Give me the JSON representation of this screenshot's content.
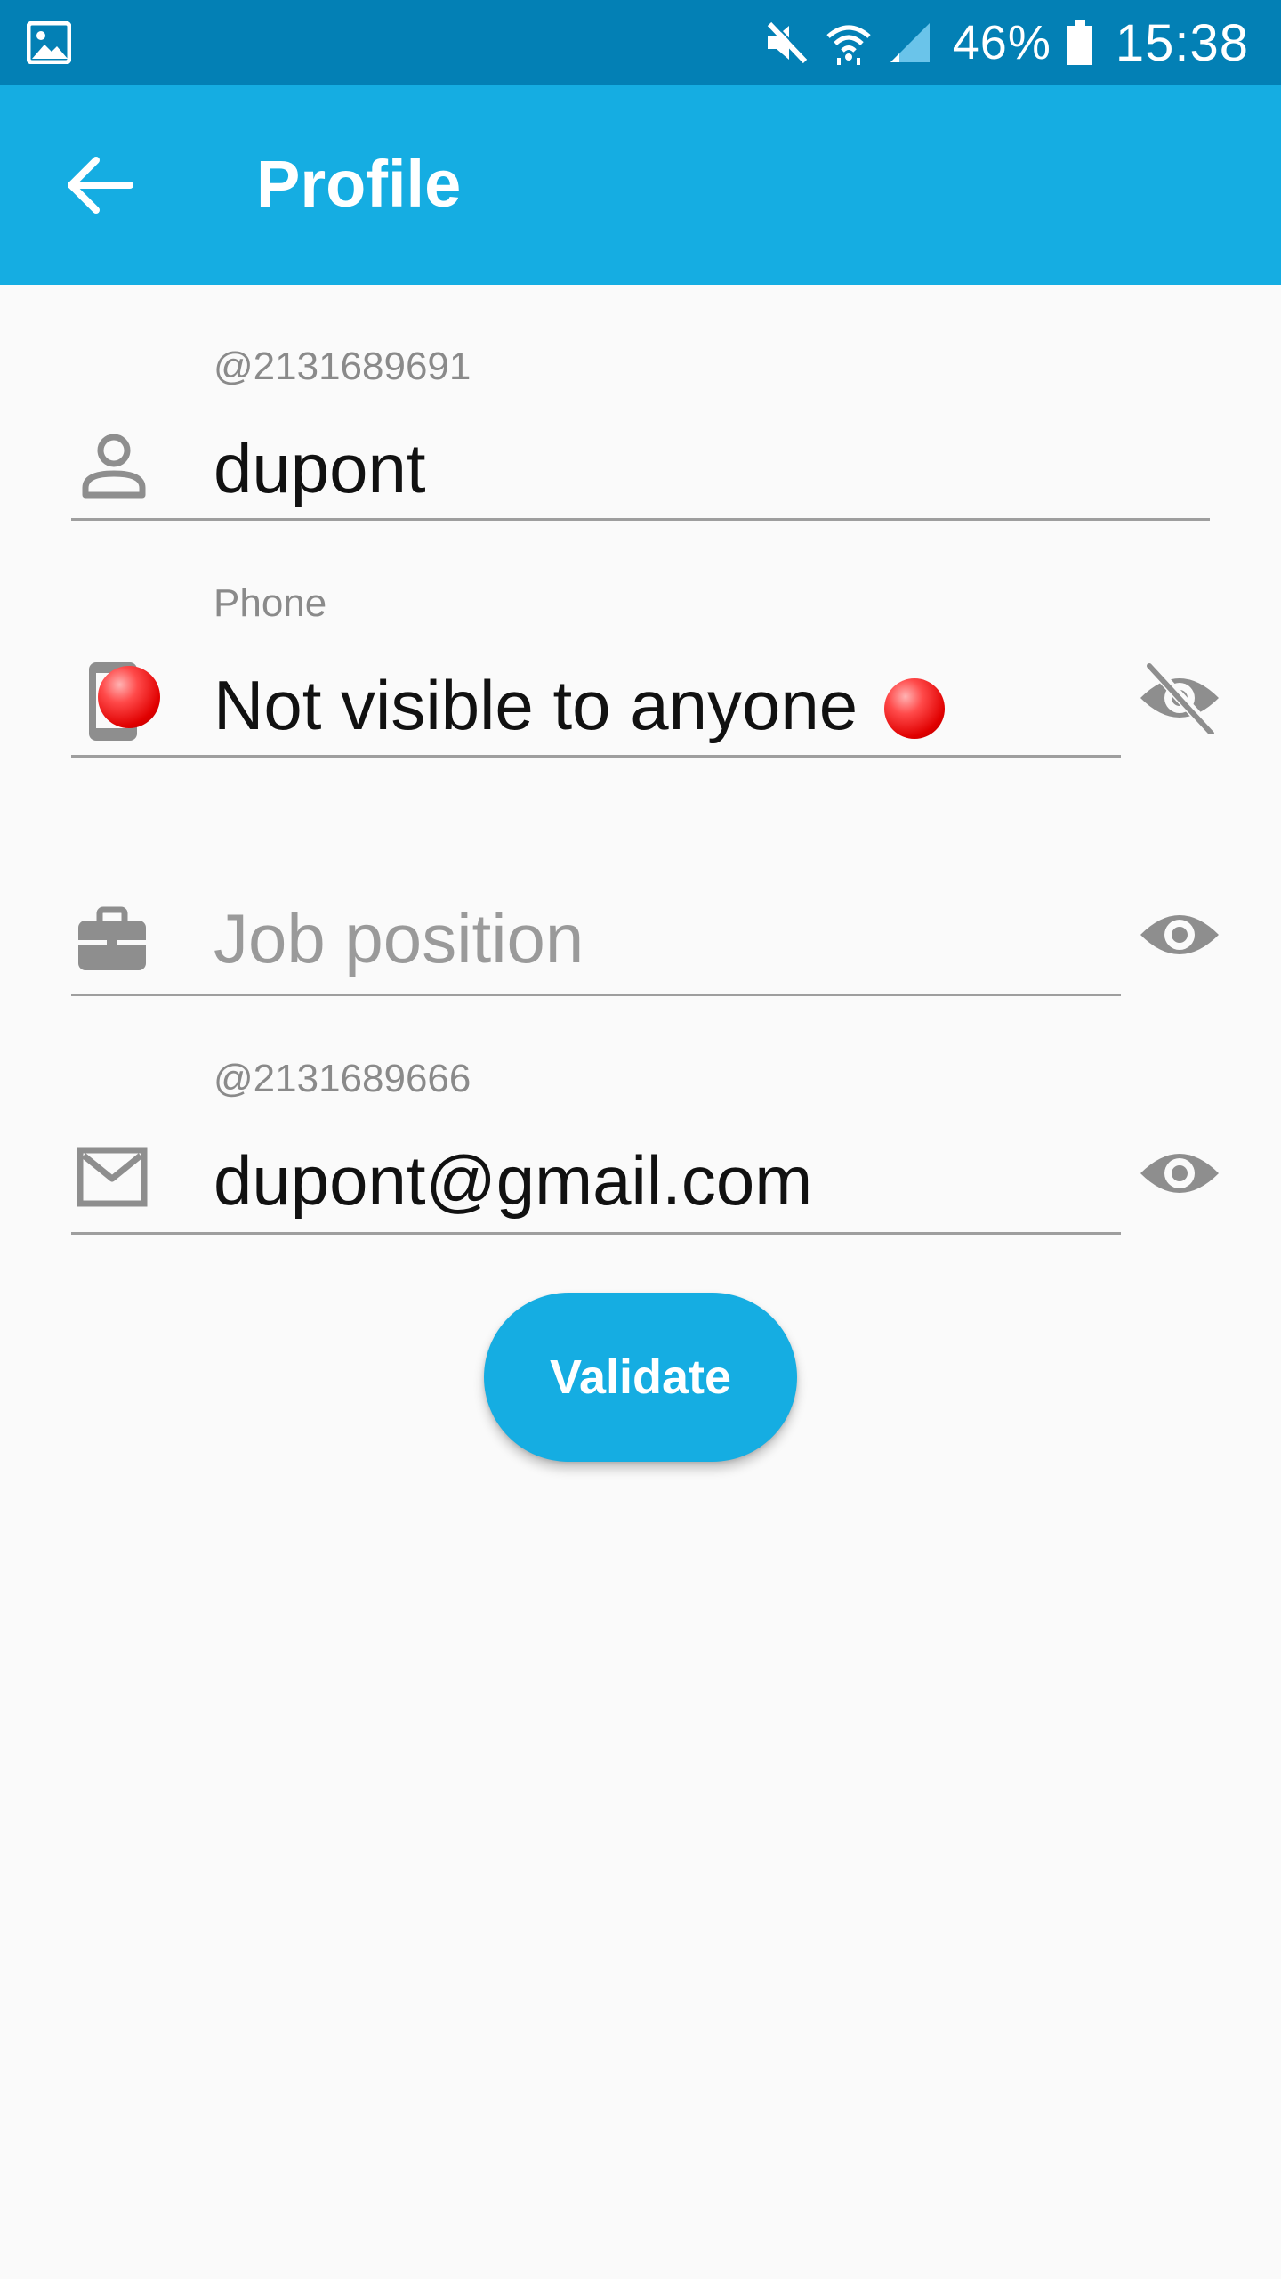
{
  "status_bar": {
    "battery_percent": "46%",
    "time": "15:38",
    "icons": [
      "gallery-icon",
      "mute-icon",
      "wifi-icon",
      "signal-icon",
      "battery-icon"
    ]
  },
  "app_bar": {
    "title": "Profile",
    "back_icon": "arrow-back-icon",
    "background_color": "#15ade2"
  },
  "form": {
    "username": {
      "label": "@2131689691",
      "value": "dupont",
      "icon": "person-icon"
    },
    "phone": {
      "label": "Phone",
      "value": "Not visible to anyone",
      "icon": "phone-icon",
      "visibility_icon": "eye-off-icon"
    },
    "job": {
      "placeholder": "Job position",
      "icon": "briefcase-icon",
      "visibility_icon": "eye-icon"
    },
    "email": {
      "label": "@2131689666",
      "value": "dupont@gmail.com",
      "icon": "mail-icon",
      "visibility_icon": "eye-icon"
    }
  },
  "validate_button": {
    "label": "Validate",
    "color": "#15ade2"
  }
}
